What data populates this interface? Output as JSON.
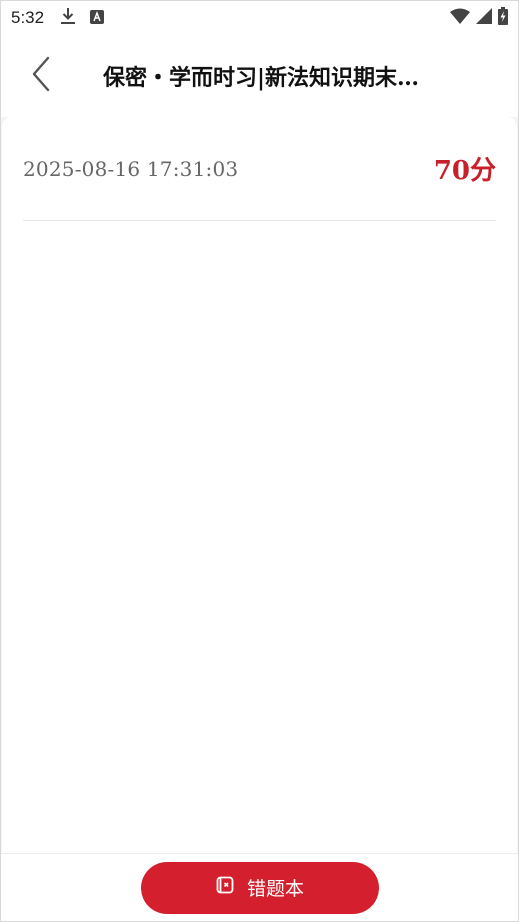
{
  "status_bar": {
    "time": "5:32",
    "left_icons": [
      "download-icon",
      "a-box-icon"
    ],
    "right_icons": [
      "wifi-icon",
      "signal-icon",
      "battery-charging-icon"
    ]
  },
  "header": {
    "back_icon": "chevron-left-icon",
    "title": "保密・学而时习|新法知识期末…"
  },
  "records": [
    {
      "time": "2025-08-16  17:31:03",
      "score": "70分"
    }
  ],
  "bottom_bar": {
    "button_label": "错题本",
    "button_icon": "notebook-icon"
  },
  "colors": {
    "accent": "#d4202e",
    "score": "#c8202b",
    "muted_text": "#666666"
  }
}
